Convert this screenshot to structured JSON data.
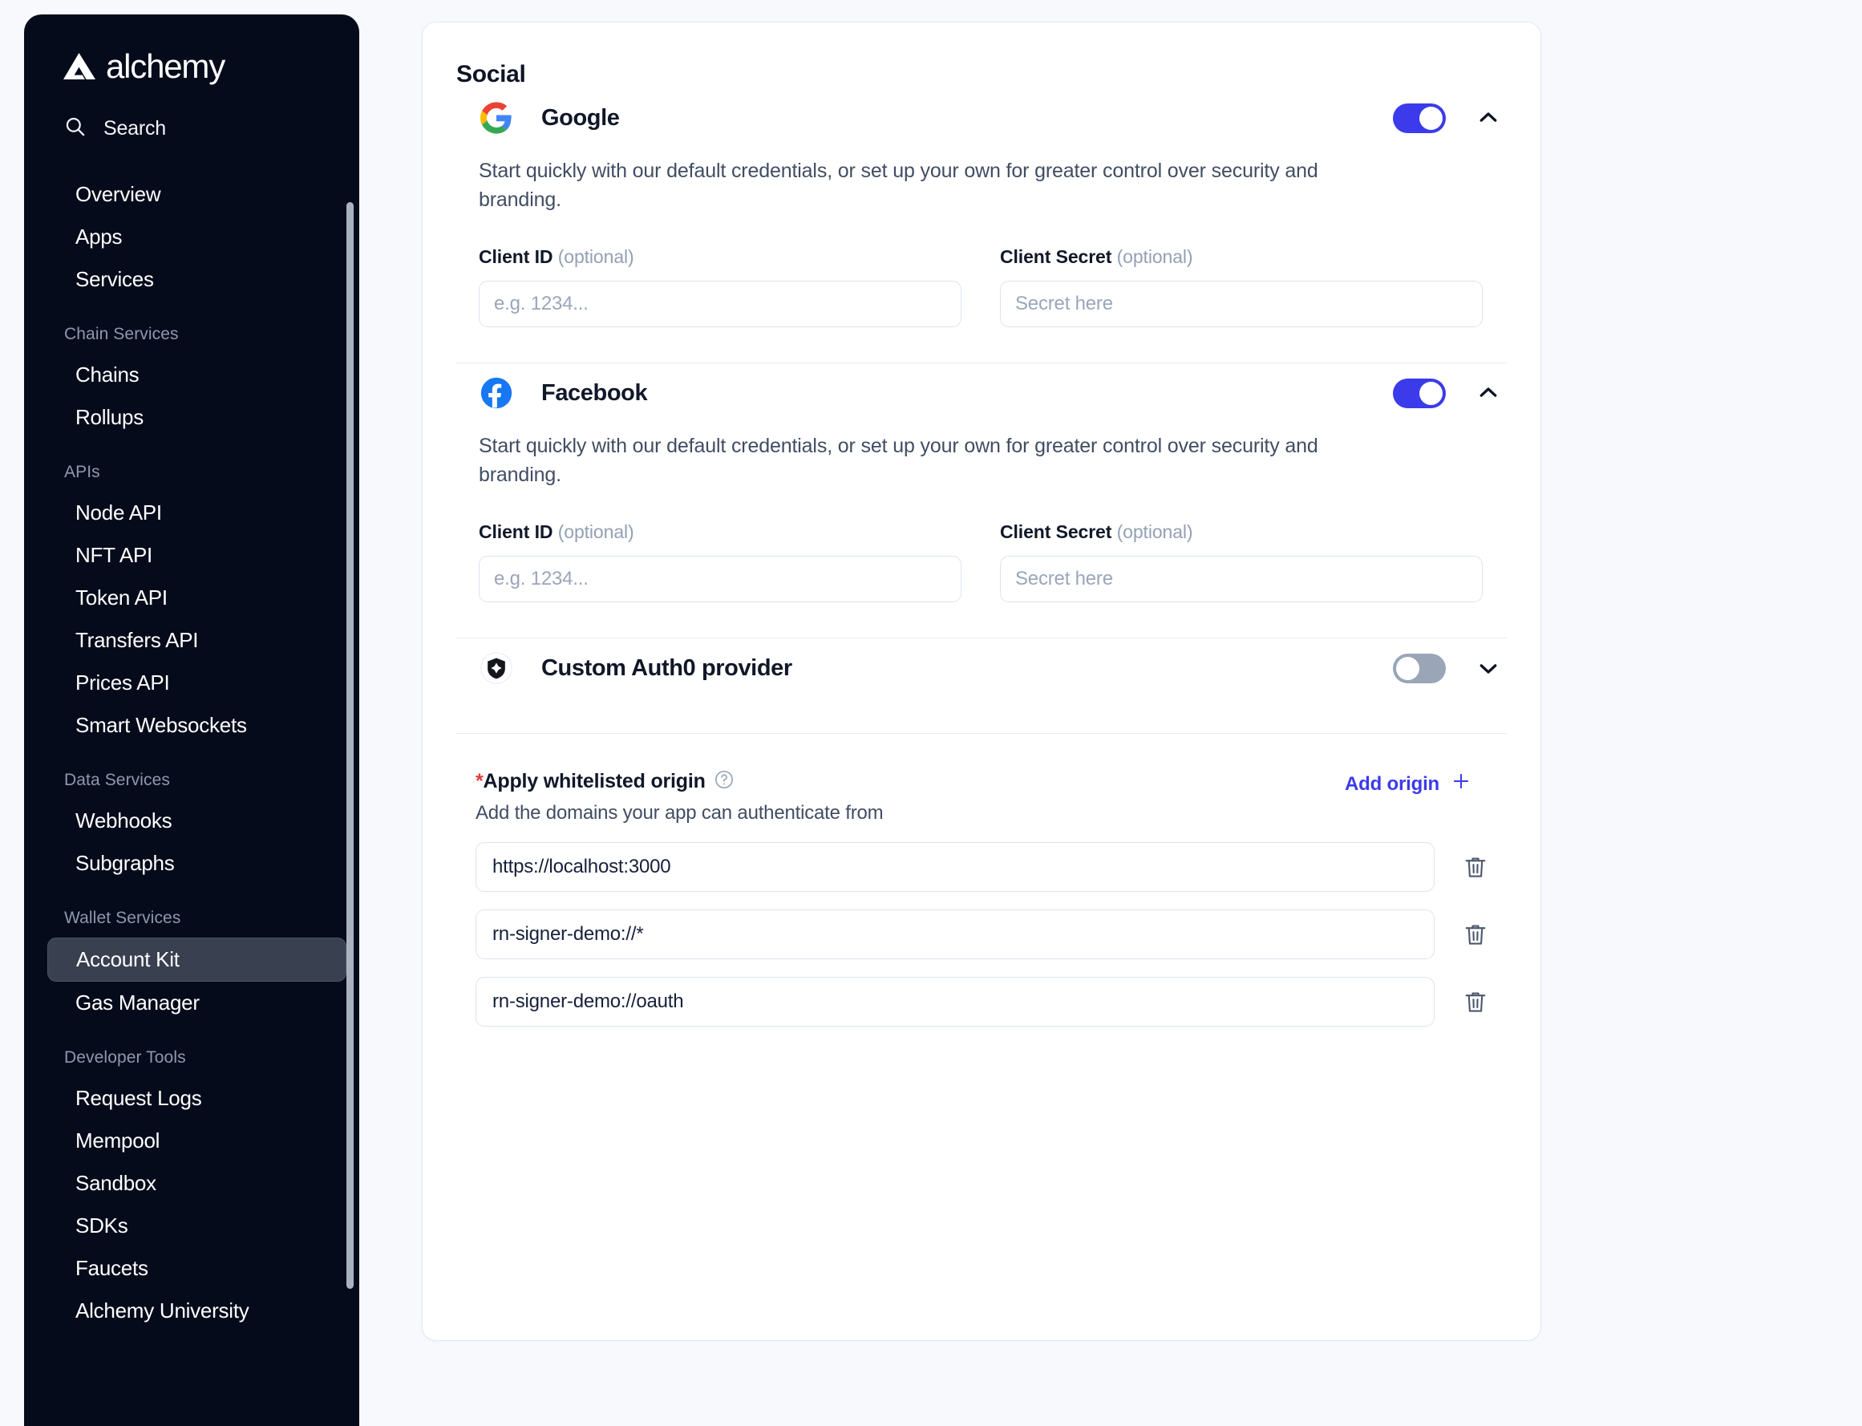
{
  "brand": {
    "name": "alchemy",
    "logo_icon": "alchemy-triangle-icon",
    "accent_blue": "#3b3beb",
    "sidebar_bg": "#060b1b",
    "page_bg": "#f7f9fd"
  },
  "sidebar": {
    "search": {
      "label": "Search",
      "icon": "search-icon"
    },
    "groups": [
      {
        "label": null,
        "items": [
          "Overview",
          "Apps",
          "Services"
        ]
      },
      {
        "label": "Chain Services",
        "items": [
          "Chains",
          "Rollups"
        ]
      },
      {
        "label": "APIs",
        "items": [
          "Node API",
          "NFT API",
          "Token API",
          "Transfers API",
          "Prices API",
          "Smart Websockets"
        ]
      },
      {
        "label": "Data Services",
        "items": [
          "Webhooks",
          "Subgraphs"
        ]
      },
      {
        "label": "Wallet Services",
        "items": [
          "Account Kit",
          "Gas Manager"
        ]
      },
      {
        "label": "Developer Tools",
        "items": [
          "Request Logs",
          "Mempool",
          "Sandbox",
          "SDKs",
          "Faucets",
          "Alchemy University"
        ]
      }
    ],
    "active_item": "Account Kit"
  },
  "card": {
    "title": "Social",
    "providers": [
      {
        "name": "Google",
        "icon": "google-icon",
        "enabled": true,
        "expanded": true,
        "chevron": "chevron-up-icon",
        "description": "Start quickly with our default credentials, or set up your own for greater control over security and branding.",
        "fields": [
          {
            "label": "Client ID",
            "optional": "(optional)",
            "value": "",
            "placeholder": "e.g. 1234..."
          },
          {
            "label": "Client Secret",
            "optional": "(optional)",
            "value": "",
            "placeholder": "Secret here"
          }
        ]
      },
      {
        "name": "Facebook",
        "icon": "facebook-icon",
        "enabled": true,
        "expanded": true,
        "chevron": "chevron-up-icon",
        "description": "Start quickly with our default credentials, or set up your own for greater control over security and branding.",
        "fields": [
          {
            "label": "Client ID",
            "optional": "(optional)",
            "value": "",
            "placeholder": "e.g. 1234..."
          },
          {
            "label": "Client Secret",
            "optional": "(optional)",
            "value": "",
            "placeholder": "Secret here"
          }
        ]
      },
      {
        "name": "Custom Auth0 provider",
        "icon": "auth0-shield-icon",
        "enabled": false,
        "expanded": false,
        "chevron": "chevron-down-icon",
        "description": null,
        "fields": []
      }
    ],
    "origins": {
      "required_marker": "*",
      "label": "Apply whitelisted origin",
      "help_icon": "question-circle-icon",
      "subtitle": "Add the domains your app can authenticate from",
      "add_label": "Add origin",
      "add_icon": "plus-icon",
      "delete_icon": "trash-icon",
      "values": [
        "https://localhost:3000",
        "rn-signer-demo://*",
        "rn-signer-demo://oauth"
      ]
    }
  }
}
